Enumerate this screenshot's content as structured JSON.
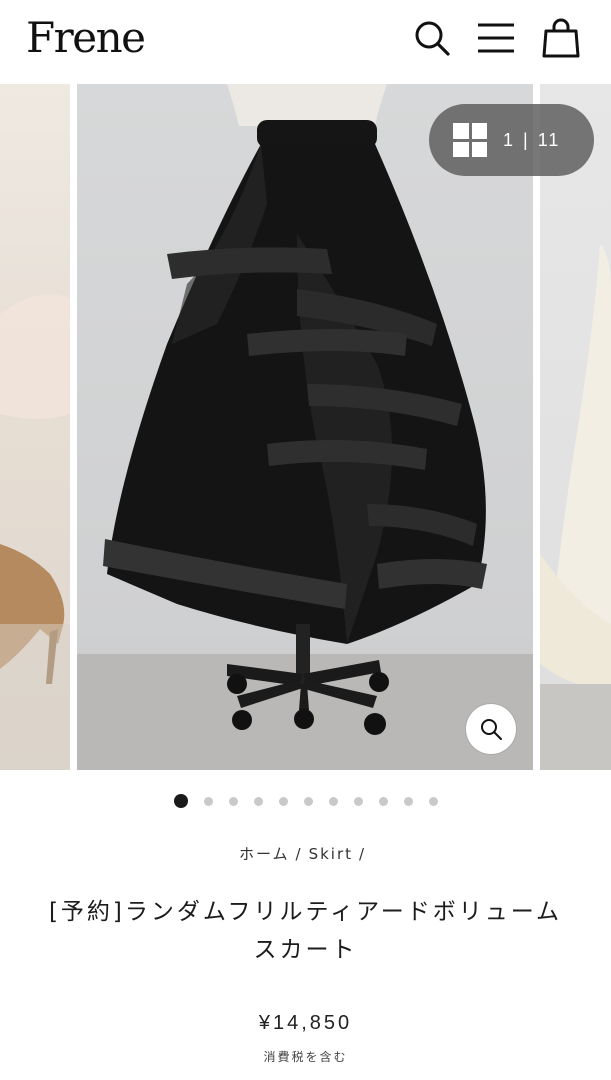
{
  "header": {
    "logo": "Frene",
    "icons": [
      "search-icon",
      "menu-icon",
      "shopping-bag-icon"
    ]
  },
  "gallery": {
    "current": "1",
    "separator": "|",
    "total": "11",
    "dots_total": 11,
    "dots_active_index": 0
  },
  "breadcrumb": {
    "home": "ホーム",
    "separator": "/",
    "category": "Skirt"
  },
  "product": {
    "title_line1": "[予約]ランダムフリルティアードボリューム",
    "title_line2": "スカート",
    "price": "¥14,850",
    "tax_note": "消費税を含む"
  },
  "colors": {
    "text": "#1c1c1c",
    "pill_bg": "#5a5a5a",
    "dot_active": "#1a1a1a",
    "dot_inactive": "#c9c9c9"
  }
}
